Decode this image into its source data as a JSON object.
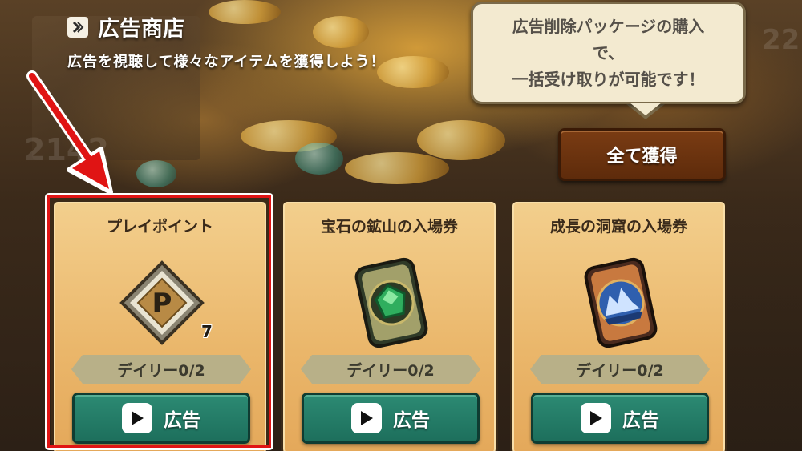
{
  "header": {
    "title": "広告商店",
    "subtitle": "広告を視聴して様々なアイテムを獲得しよう！"
  },
  "bubble": {
    "text": "広告削除パッケージの購入\nで、\n一括受け取りが可能です！"
  },
  "claim_all_label": "全て獲得",
  "cards": [
    {
      "title": "プレイポイント",
      "quantity": "7",
      "daily": "デイリー0/2",
      "ad_label": "広告",
      "icon": "play-point-coin-icon"
    },
    {
      "title": "宝石の鉱山の入場券",
      "daily": "デイリー0/2",
      "ad_label": "広告",
      "icon": "emerald-ticket-icon"
    },
    {
      "title": "成長の洞窟の入場券",
      "daily": "デイリー0/2",
      "ad_label": "広告",
      "icon": "cave-ticket-icon"
    }
  ],
  "colors": {
    "highlight": "#e01414",
    "annotation_arrow": "#e01414",
    "ad_button": "#1d6f5c",
    "claim_all": "#6a320f",
    "card": "#eab66a"
  }
}
